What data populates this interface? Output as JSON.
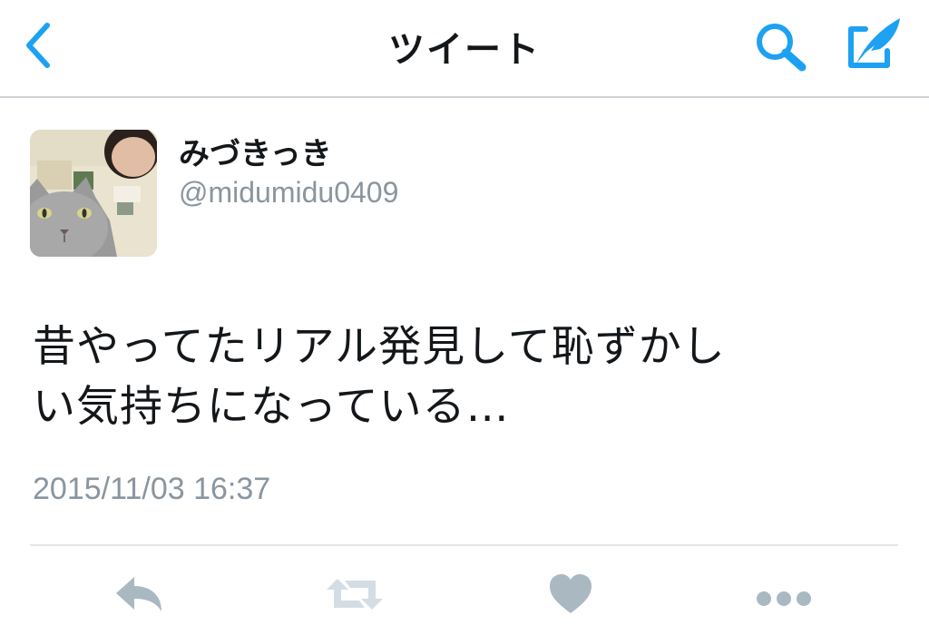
{
  "colors": {
    "accent": "#1da1f2",
    "text_primary": "#14171a",
    "text_secondary": "#8a959f",
    "action_icon": "#aab8c2",
    "divider": "#e1e6ea"
  },
  "navbar": {
    "title": "ツイート",
    "back_icon": "chevron-left-icon",
    "search_icon": "search-icon",
    "compose_icon": "compose-tweet-icon"
  },
  "author": {
    "display_name": "みづきっき",
    "handle": "@midumidu0409"
  },
  "tweet": {
    "text_line1": "昔やってたリアル発見して恥ずかし",
    "text_line2": "い気持ちになっている…",
    "timestamp": "2015/11/03 16:37"
  },
  "actions": [
    {
      "name": "reply",
      "icon": "reply-icon"
    },
    {
      "name": "retweet",
      "icon": "retweet-icon"
    },
    {
      "name": "like",
      "icon": "heart-icon"
    },
    {
      "name": "more",
      "icon": "more-icon"
    }
  ]
}
